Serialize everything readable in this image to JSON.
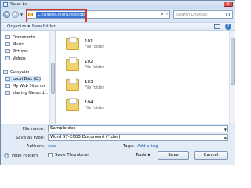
{
  "window": {
    "title": "Save As",
    "close_label": "x"
  },
  "address": {
    "path": "C:\\Users\\Test\\Desktop",
    "search_placeholder": "Search Desktop"
  },
  "toolbar": {
    "organize": "Organize ▾",
    "new_folder": "New folder"
  },
  "nav": {
    "items": [
      {
        "label": "Documents",
        "icon": "documents-icon"
      },
      {
        "label": "Music",
        "icon": "music-icon"
      },
      {
        "label": "Pictures",
        "icon": "pictures-icon"
      },
      {
        "label": "Videos",
        "icon": "videos-icon"
      },
      {
        "label": "Computer",
        "icon": "computer-icon"
      },
      {
        "label": "Local Disk (C:)",
        "icon": "disk-icon"
      },
      {
        "label": "My Web Sites on",
        "icon": "web-sites-icon"
      },
      {
        "label": "sharing file on d...",
        "icon": "shared-folder-icon"
      }
    ]
  },
  "files": [
    {
      "name": "101",
      "type": "File folder"
    },
    {
      "name": "102",
      "type": "File folder"
    },
    {
      "name": "103",
      "type": "File folder"
    },
    {
      "name": "104",
      "type": "File folder"
    }
  ],
  "form": {
    "file_name_label": "File name:",
    "file_name_value": "Sample.doc",
    "save_type_label": "Save as type:",
    "save_type_value": "Word 97-2003 Document (*.doc)",
    "authors_label": "Authors:",
    "authors_value": "ccw",
    "tags_label": "Tags:",
    "tags_value": "Add a tag",
    "thumbnail_label": "Save Thumbnail"
  },
  "footer": {
    "hide_folders": "Hide Folders",
    "tools": "Tools",
    "save": "Save",
    "cancel": "Cancel"
  }
}
